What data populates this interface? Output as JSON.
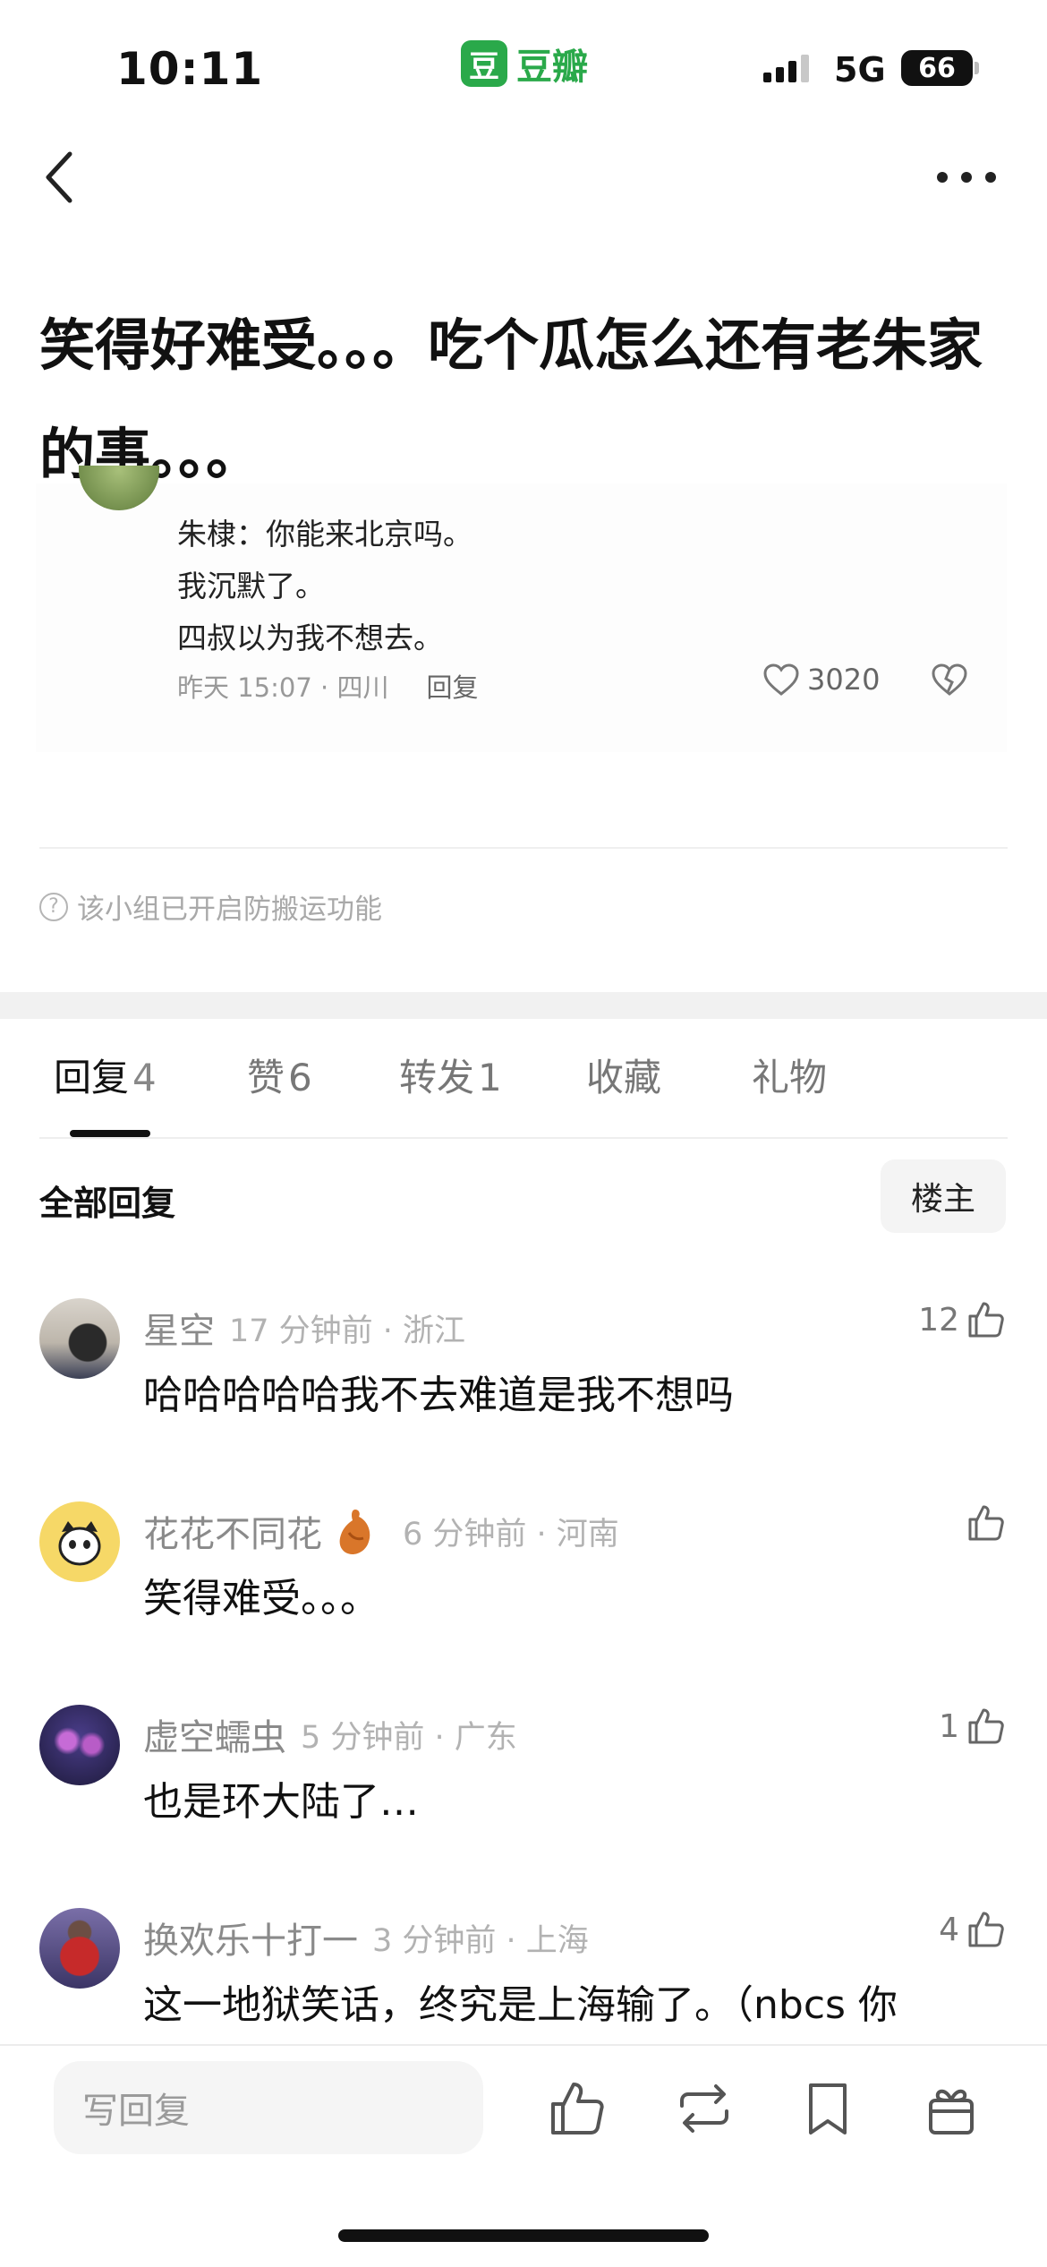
{
  "status_bar": {
    "time": "10:11",
    "carrier_logo": "豆",
    "carrier_name": "豆瓣",
    "network": "5G",
    "battery": "66"
  },
  "post": {
    "title": "笑得好难受。。。吃个瓜怎么还有老朱家的事。。。",
    "quoted_card": {
      "lines": [
        "朱棣：你能来北京吗。",
        "我沉默了。",
        "四叔以为我不想去。"
      ],
      "meta": "昨天 15:07 · 四川",
      "reply_label": "回复",
      "likes": "3020"
    },
    "notice": "该小组已开启防搬运功能"
  },
  "tabs": [
    {
      "label": "回复",
      "count": "4"
    },
    {
      "label": "赞",
      "count": "6"
    },
    {
      "label": "转发",
      "count": "1"
    },
    {
      "label": "收藏",
      "count": ""
    },
    {
      "label": "礼物",
      "count": ""
    }
  ],
  "replies_header": {
    "title": "全部回复",
    "op_filter": "楼主"
  },
  "comments": [
    {
      "user": "星空",
      "meta": "17 分钟前 · 浙江",
      "text": "哈哈哈哈哈我不去难道是我不想吗",
      "likes": "12"
    },
    {
      "user": "花花不同花",
      "meta": "6 分钟前 · 河南",
      "text": "笑得难受。。。",
      "likes": ""
    },
    {
      "user": "虚空蠕虫",
      "meta": "5 分钟前 · 广东",
      "text": "也是环大陆了…",
      "likes": "1"
    },
    {
      "user": "换欢乐十打一",
      "meta": "3 分钟前 · 上海",
      "text": "这一地狱笑话，终究是上海输了。（nbcs 你",
      "likes": "4"
    }
  ],
  "bottom_bar": {
    "input_placeholder": "写回复",
    "icons": [
      "thumbs-up-icon",
      "repost-icon",
      "bookmark-icon",
      "gift-icon"
    ]
  },
  "colors": {
    "brand_green": "#2aa94a",
    "text_primary": "#111111",
    "text_secondary": "#8a8a8a"
  }
}
